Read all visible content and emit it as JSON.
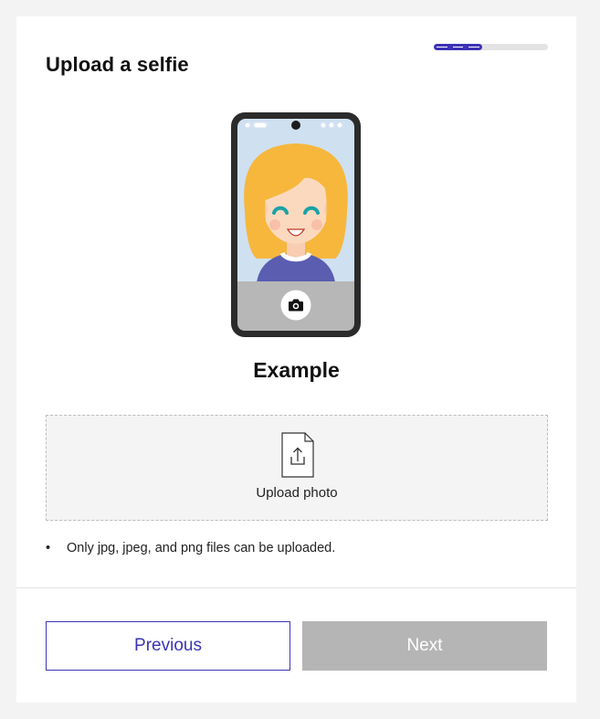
{
  "header": {
    "title": "Upload a selfie",
    "progress": {
      "fraction": 0.42,
      "steps": 3,
      "color": "#3d33b4",
      "track_color": "#e3e3e3"
    }
  },
  "example": {
    "label": "Example",
    "illustration": "phone-selfie-illustration",
    "camera_icon": "camera-icon"
  },
  "upload": {
    "label": "Upload photo",
    "icon": "file-upload-icon"
  },
  "rules": [
    "Only jpg, jpeg, and png files can be uploaded."
  ],
  "footer": {
    "previous_label": "Previous",
    "next_label": "Next",
    "accent_color": "#3d33b4",
    "disabled_color": "#b5b5b5"
  }
}
